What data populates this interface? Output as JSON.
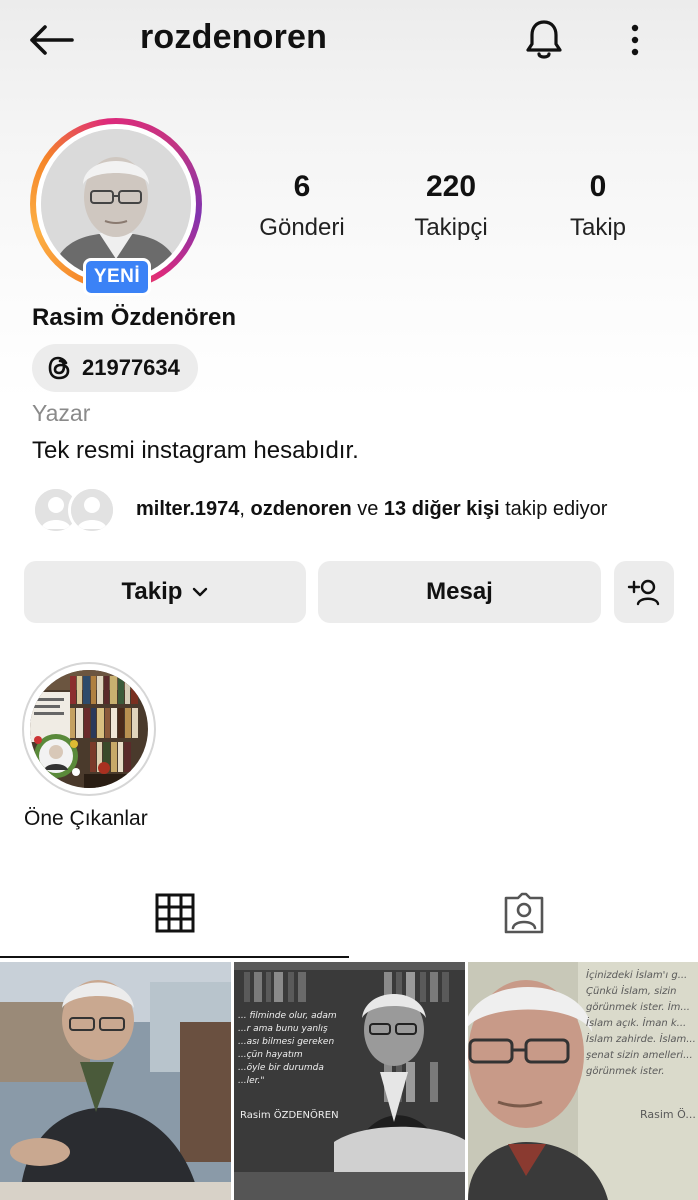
{
  "header": {
    "username": "rozdenoren",
    "back_icon": "arrow-left-icon",
    "notifications_icon": "bell-icon",
    "more_icon": "more-vertical-icon"
  },
  "profile": {
    "new_badge": "YENİ",
    "display_name": "Rasim Özdenören",
    "threads_handle": "21977634",
    "category": "Yazar",
    "bio": "Tek resmi instagram hesabıdır."
  },
  "stats": [
    {
      "value": "6",
      "label": "Gönderi"
    },
    {
      "value": "220",
      "label": "Takipçi"
    },
    {
      "value": "0",
      "label": "Takip"
    }
  ],
  "followed_by": {
    "user1": "milter.1974",
    "sep1": ", ",
    "user2": "ozdenoren",
    "conj": " ve ",
    "others": "13 diğer kişi",
    "suffix": " takip ediyor"
  },
  "actions": {
    "follow_label": "Takip",
    "message_label": "Mesaj"
  },
  "highlights": [
    {
      "label": "Öne Çıkanlar"
    }
  ],
  "posts": [
    {
      "quote": "",
      "signature": ""
    },
    {
      "quote": "... filminde olur, adam\n...r ama bunu yanlış\n...ası bilmesi gereken\n...çün hayatım\n...öyle bir durumda\n...ler.\"",
      "signature": "Rasim ÖZDENÖREN"
    },
    {
      "quote": "İçinizdeki İslam'ı g...\nÇünkü İslam, sizin\ngörünmek ister. İm...\nİslam açık. İman k...\nİslam zahirde. İslam...\nşenat sizin amelleri...\ngörünmek ister.",
      "signature": "Rasim Ö..."
    }
  ],
  "colors": {
    "badge_blue": "#3b82f6",
    "button_gray": "#ececec"
  }
}
